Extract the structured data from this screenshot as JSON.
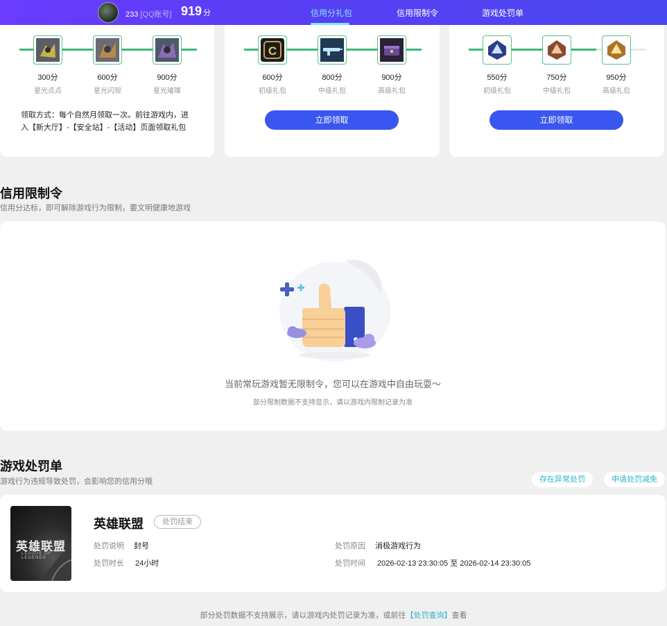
{
  "header": {
    "user_id": "233",
    "account_type": "[QQ账号]",
    "score": "919",
    "score_unit": "分",
    "tabs": [
      "信用分礼包",
      "信用限制令",
      "游戏处罚单"
    ]
  },
  "reward_cards": [
    {
      "items": [
        {
          "value": "300分",
          "name": "星光点点",
          "icon": "starlight-dot-icon"
        },
        {
          "value": "600分",
          "name": "星光闪现",
          "icon": "starlight-flash-icon"
        },
        {
          "value": "900分",
          "name": "星光璀璨",
          "icon": "starlight-brilliant-icon"
        }
      ],
      "note": "领取方式：每个自然月领取一次。前往游戏内，进入【新大厅】-【安全站】-【活动】页面领取礼包"
    },
    {
      "items": [
        {
          "value": "600分",
          "name": "初级礼包",
          "icon": "c-badge-icon"
        },
        {
          "value": "800分",
          "name": "中级礼包",
          "icon": "rifle-icon"
        },
        {
          "value": "900分",
          "name": "高级礼包",
          "icon": "crate-icon"
        }
      ],
      "button": "立即领取"
    },
    {
      "items": [
        {
          "value": "550分",
          "name": "初级礼包",
          "icon": "rank-blue-icon"
        },
        {
          "value": "750分",
          "name": "中级礼包",
          "icon": "rank-bronze-icon"
        },
        {
          "value": "950分",
          "name": "高级礼包",
          "icon": "rank-gold-icon"
        }
      ],
      "button": "立即领取"
    }
  ],
  "restriction": {
    "title": "信用限制令",
    "subtitle": "信用分达标，即可解除游戏行为限制，要文明健康地游戏",
    "empty_main": "当前常玩游戏暂无限制令，您可以在游戏中自由玩耍～",
    "empty_sub": "部分限制数据不支持显示，请以游戏内限制记录为准"
  },
  "penalty": {
    "title": "游戏处罚单",
    "subtitle": "游戏行为违规导致处罚，会影响您的信用分哦",
    "btn_abnormal": "存在异常处罚",
    "btn_reduce": "申请处罚减免",
    "record": {
      "thumb_title": "英雄联盟",
      "thumb_sub": "LEAGUE OF LEGENDS",
      "game": "英雄联盟",
      "status": "处罚结束",
      "desc_label": "处罚说明",
      "desc_value": "封号",
      "duration_label": "处罚时长",
      "duration_value": "24小时",
      "reason_label": "处罚原因",
      "reason_value": "消极游戏行为",
      "time_label": "处罚时间",
      "time_value": "2026-02-13 23:30:05 至 2026-02-14 23:30:05"
    }
  },
  "footer": {
    "text": "部分处罚数据不支持展示，请以游戏内处罚记录为准，或前往",
    "link": "【处罚查询】",
    "suffix": "查看"
  },
  "colors": {
    "header": "#5a3df5",
    "primary_button": "#3a56f0",
    "track": "#3cb878",
    "accent_link": "#2db4c8"
  }
}
